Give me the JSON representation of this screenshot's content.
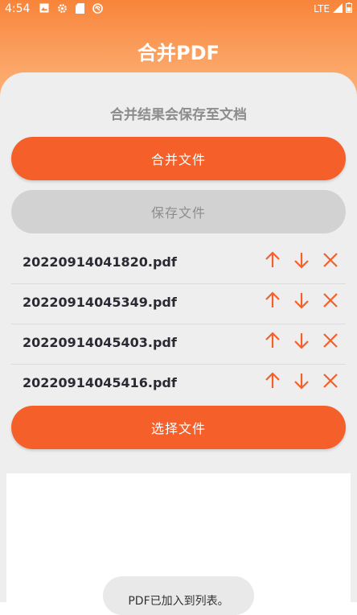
{
  "status_bar": {
    "time": "4:54",
    "network": "LTE"
  },
  "header": {
    "title": "合并PDF"
  },
  "main": {
    "hint": "合并结果会保存至文档",
    "merge_label": "合并文件",
    "save_label": "保存文件",
    "select_label": "选择文件",
    "files": [
      {
        "name": "20220914041820.pdf"
      },
      {
        "name": "20220914045349.pdf"
      },
      {
        "name": "20220914045403.pdf"
      },
      {
        "name": "20220914045416.pdf"
      }
    ]
  },
  "toast": {
    "message": "PDF已加入到列表。"
  },
  "colors": {
    "accent": "#f5602a",
    "card": "#eeeeee",
    "disabled": "#d2d2d2"
  }
}
